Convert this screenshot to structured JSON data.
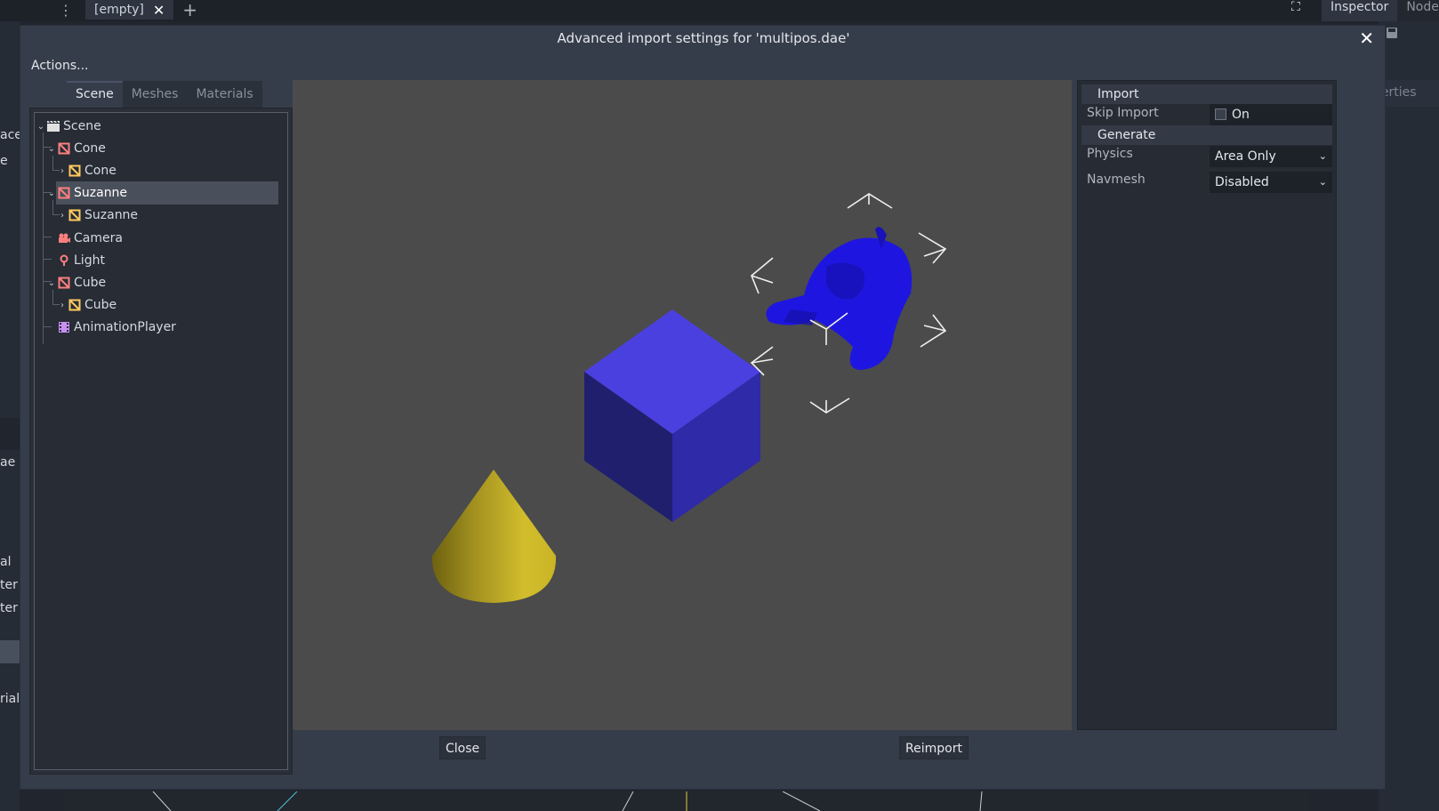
{
  "background_editor": {
    "scene_tab": "[empty]",
    "right_tabs": {
      "inspector": "Inspector",
      "node": "Node"
    },
    "properties_fragment": "perties",
    "left_dock_fragments": [
      "ace",
      "e",
      "ae",
      "al",
      "ter",
      "ter",
      "rial"
    ]
  },
  "dialog": {
    "title": "Advanced import settings for 'multipos.dae'",
    "actions_menu": "Actions...",
    "tabs": [
      "Scene",
      "Meshes",
      "Materials"
    ],
    "tree": [
      {
        "label": "Scene",
        "icon": "scene-icon"
      },
      {
        "label": "Cone",
        "icon": "node-icon"
      },
      {
        "label": "Cone",
        "icon": "mesh-icon"
      },
      {
        "label": "Suzanne",
        "icon": "node-icon"
      },
      {
        "label": "Suzanne",
        "icon": "mesh-icon"
      },
      {
        "label": "Camera",
        "icon": "camera-icon"
      },
      {
        "label": "Light",
        "icon": "light-icon"
      },
      {
        "label": "Cube",
        "icon": "node-icon"
      },
      {
        "label": "Cube",
        "icon": "mesh-icon"
      },
      {
        "label": "AnimationPlayer",
        "icon": "animation-icon"
      }
    ],
    "selected_item": "Suzanne",
    "inspector": {
      "import_section": "Import",
      "skip_import_label": "Skip Import",
      "skip_import_value": "On",
      "generate_section": "Generate",
      "physics_label": "Physics",
      "physics_value": "Area Only",
      "navmesh_label": "Navmesh",
      "navmesh_value": "Disabled"
    },
    "buttons": {
      "close": "Close",
      "reimport": "Reimport"
    },
    "colors": {
      "dialog_bg": "#363d4a",
      "viewport_bg": "#4b4b4b",
      "cube_top": "#4a40e0",
      "cube_left": "#201f6e",
      "cube_right": "#2e2aa8",
      "cone": "#c7b325",
      "suzanne": "#1e16e0",
      "node_icon": "#fc7f7f",
      "mesh_icon": "#ffca5f"
    }
  }
}
